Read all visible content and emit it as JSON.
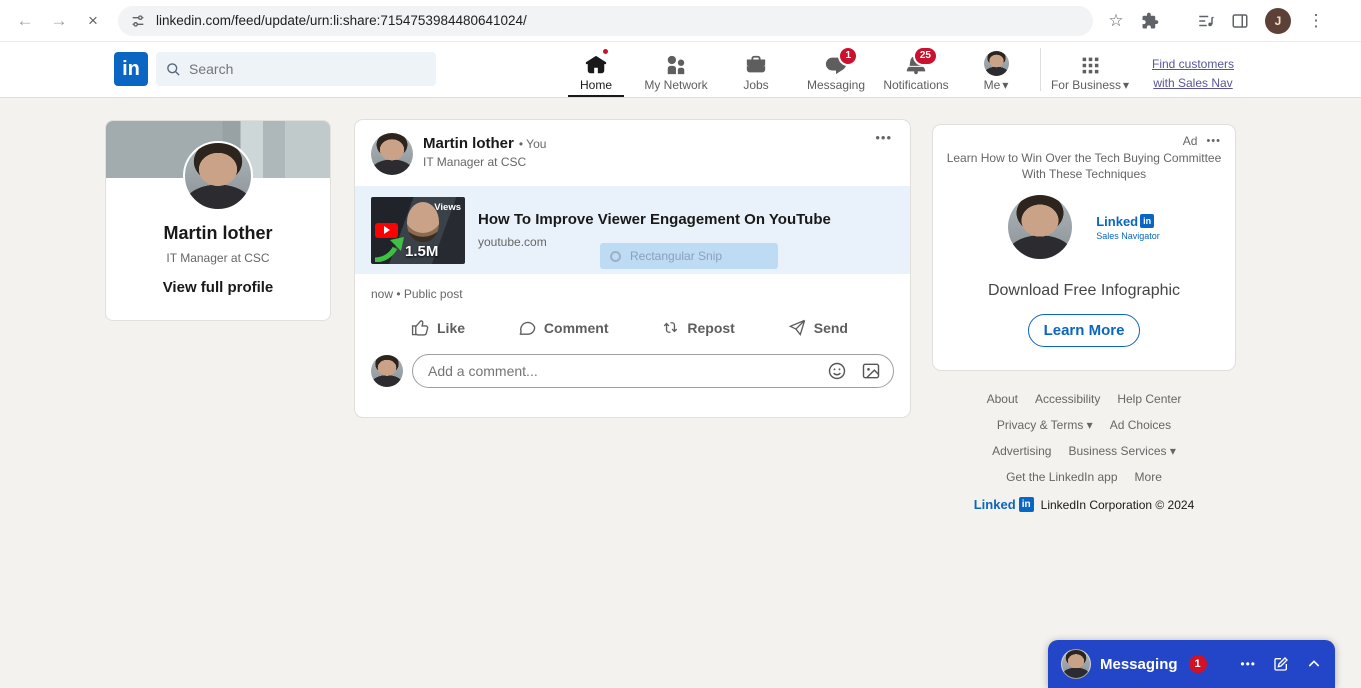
{
  "colors": {
    "linkedin_blue": "#0a66c2",
    "badge_red": "#cb112d",
    "page_background": "#f4f2ee",
    "messaging_bar_blue": "#2346c8",
    "preview_strip_blue": "#e9f2fa"
  },
  "icons": {
    "back": "←",
    "forward": "→",
    "stop": "×",
    "bookmark_star": "☆",
    "menu_dots_vertical": "⋮",
    "dots_horizontal": "•••",
    "chevron_down": "▾"
  },
  "browser": {
    "url": "linkedin.com/feed/update/urn:li:share:7154753984480641024/",
    "avatar_initial": "J"
  },
  "header": {
    "logo": "in",
    "search_placeholder": "Search",
    "nav_items": [
      {
        "label": "Home"
      },
      {
        "label": "My Network"
      },
      {
        "label": "Jobs"
      },
      {
        "label": "Messaging",
        "badge": "1"
      },
      {
        "label": "Notifications",
        "badge": "25"
      },
      {
        "label": "Me"
      }
    ],
    "for_business": "For Business",
    "sales_nav": "Find customers with Sales Nav"
  },
  "profile_card": {
    "name": "Martin lother",
    "headline": "IT Manager at CSC",
    "view_profile": "View full profile"
  },
  "post": {
    "author": "Martin lother",
    "author_badge": "• You",
    "author_headline": "IT Manager at CSC",
    "thumbnail": {
      "views_label": "Views",
      "views_value": "1.5M"
    },
    "link_title": "How To Improve Viewer Engagement On YouTube",
    "link_domain": "youtube.com",
    "snip_tooltip": "Rectangular Snip",
    "meta": "now • Public post",
    "actions": [
      {
        "label": "Like"
      },
      {
        "label": "Comment"
      },
      {
        "label": "Repost"
      },
      {
        "label": "Send"
      }
    ],
    "comment_placeholder": "Add a comment..."
  },
  "ad": {
    "label": "Ad",
    "body": "Learn How to Win Over the Tech Buying Committee With These Techniques",
    "logo_word": "Linked",
    "logo_square": "in",
    "logo_product": "Sales Navigator",
    "cta_text": "Download Free Infographic",
    "button_label": "Learn More"
  },
  "footer": {
    "rows": [
      [
        "About",
        "Accessibility",
        "Help Center"
      ],
      [
        "Privacy & Terms ▾",
        "Ad Choices"
      ],
      [
        "Advertising",
        "Business Services ▾"
      ],
      [
        "Get the LinkedIn app",
        "More"
      ]
    ],
    "logo_word": "Linked",
    "logo_square": "in",
    "copyright": "LinkedIn Corporation © 2024"
  },
  "messaging_panel": {
    "title": "Messaging",
    "badge": "1"
  }
}
